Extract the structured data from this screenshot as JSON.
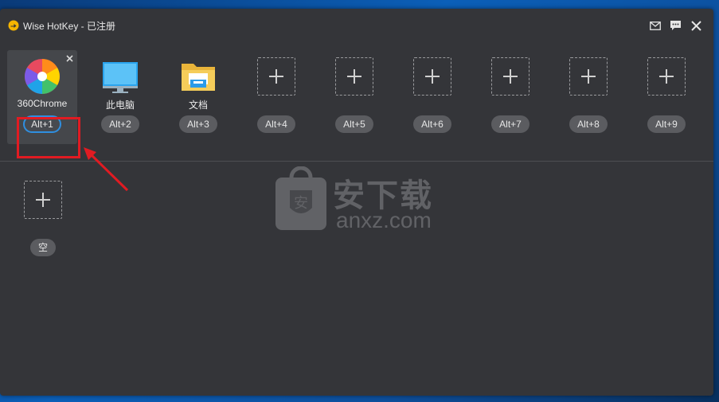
{
  "window": {
    "title": "Wise HotKey - 已注册"
  },
  "slots": [
    {
      "label": "360Chrome",
      "hotkey": "Alt+1",
      "icon": "360chrome-icon"
    },
    {
      "label": "此电脑",
      "hotkey": "Alt+2",
      "icon": "monitor-icon"
    },
    {
      "label": "文档",
      "hotkey": "Alt+3",
      "icon": "folder-icon"
    },
    {
      "label": "",
      "hotkey": "Alt+4",
      "icon": "plus-icon"
    },
    {
      "label": "",
      "hotkey": "Alt+5",
      "icon": "plus-icon"
    },
    {
      "label": "",
      "hotkey": "Alt+6",
      "icon": "plus-icon"
    },
    {
      "label": "",
      "hotkey": "Alt+7",
      "icon": "plus-icon"
    },
    {
      "label": "",
      "hotkey": "Alt+8",
      "icon": "plus-icon"
    },
    {
      "label": "",
      "hotkey": "Alt+9",
      "icon": "plus-icon"
    }
  ],
  "extra": {
    "empty_label": "空"
  },
  "watermark": {
    "cn": "安下载",
    "en": "anxz.com",
    "shield": "安"
  },
  "colors": {
    "window_bg": "#343539",
    "pill_bg": "#5b5c60",
    "selected_border": "#2f8fe0",
    "annotation_red": "#e11b22"
  }
}
